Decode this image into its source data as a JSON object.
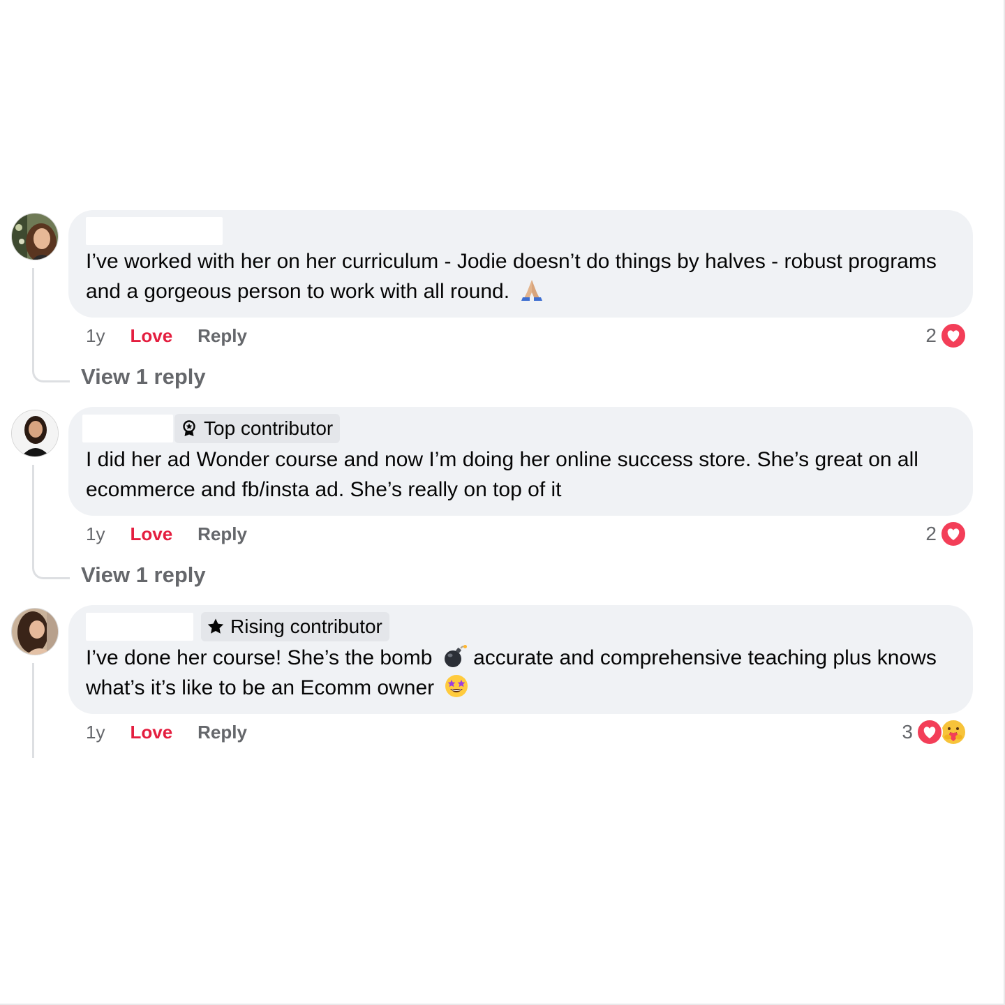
{
  "comments": [
    {
      "text": "I’ve worked with her on her curriculum - Jodie doesn’t do things by halves - robust programs and a gorgeous person to work with all round.",
      "emoji": "folded-hands-icon",
      "badge": null,
      "time": "1y",
      "love_label": "Love",
      "reply_label": "Reply",
      "reaction_count": "2",
      "reactions": [
        "love-reaction-icon"
      ],
      "view_replies": "View 1 reply"
    },
    {
      "text": "I did her ad Wonder course and now I’m doing her online success store. She’s great on all ecommerce and fb/insta ad. She’s really on top of it",
      "badge": {
        "icon": "award-icon",
        "label": "Top contributor"
      },
      "time": "1y",
      "love_label": "Love",
      "reply_label": "Reply",
      "reaction_count": "2",
      "reactions": [
        "love-reaction-icon"
      ],
      "view_replies": "View 1 reply"
    },
    {
      "text_before": "I’ve done her course! She’s the bomb",
      "text_middle": "accurate and comprehensive teaching plus knows what’s it’s like to be an Ecomm owner",
      "badge": {
        "icon": "star-icon",
        "label": "Rising contributor"
      },
      "time": "1y",
      "love_label": "Love",
      "reply_label": "Reply",
      "reaction_count": "3",
      "reactions": [
        "love-reaction-icon",
        "care-reaction-icon"
      ]
    }
  ],
  "colors": {
    "bubble": "#f0f2f5",
    "love": "#e41e3f",
    "meta": "#65676b",
    "badge": "#e4e6ea"
  }
}
